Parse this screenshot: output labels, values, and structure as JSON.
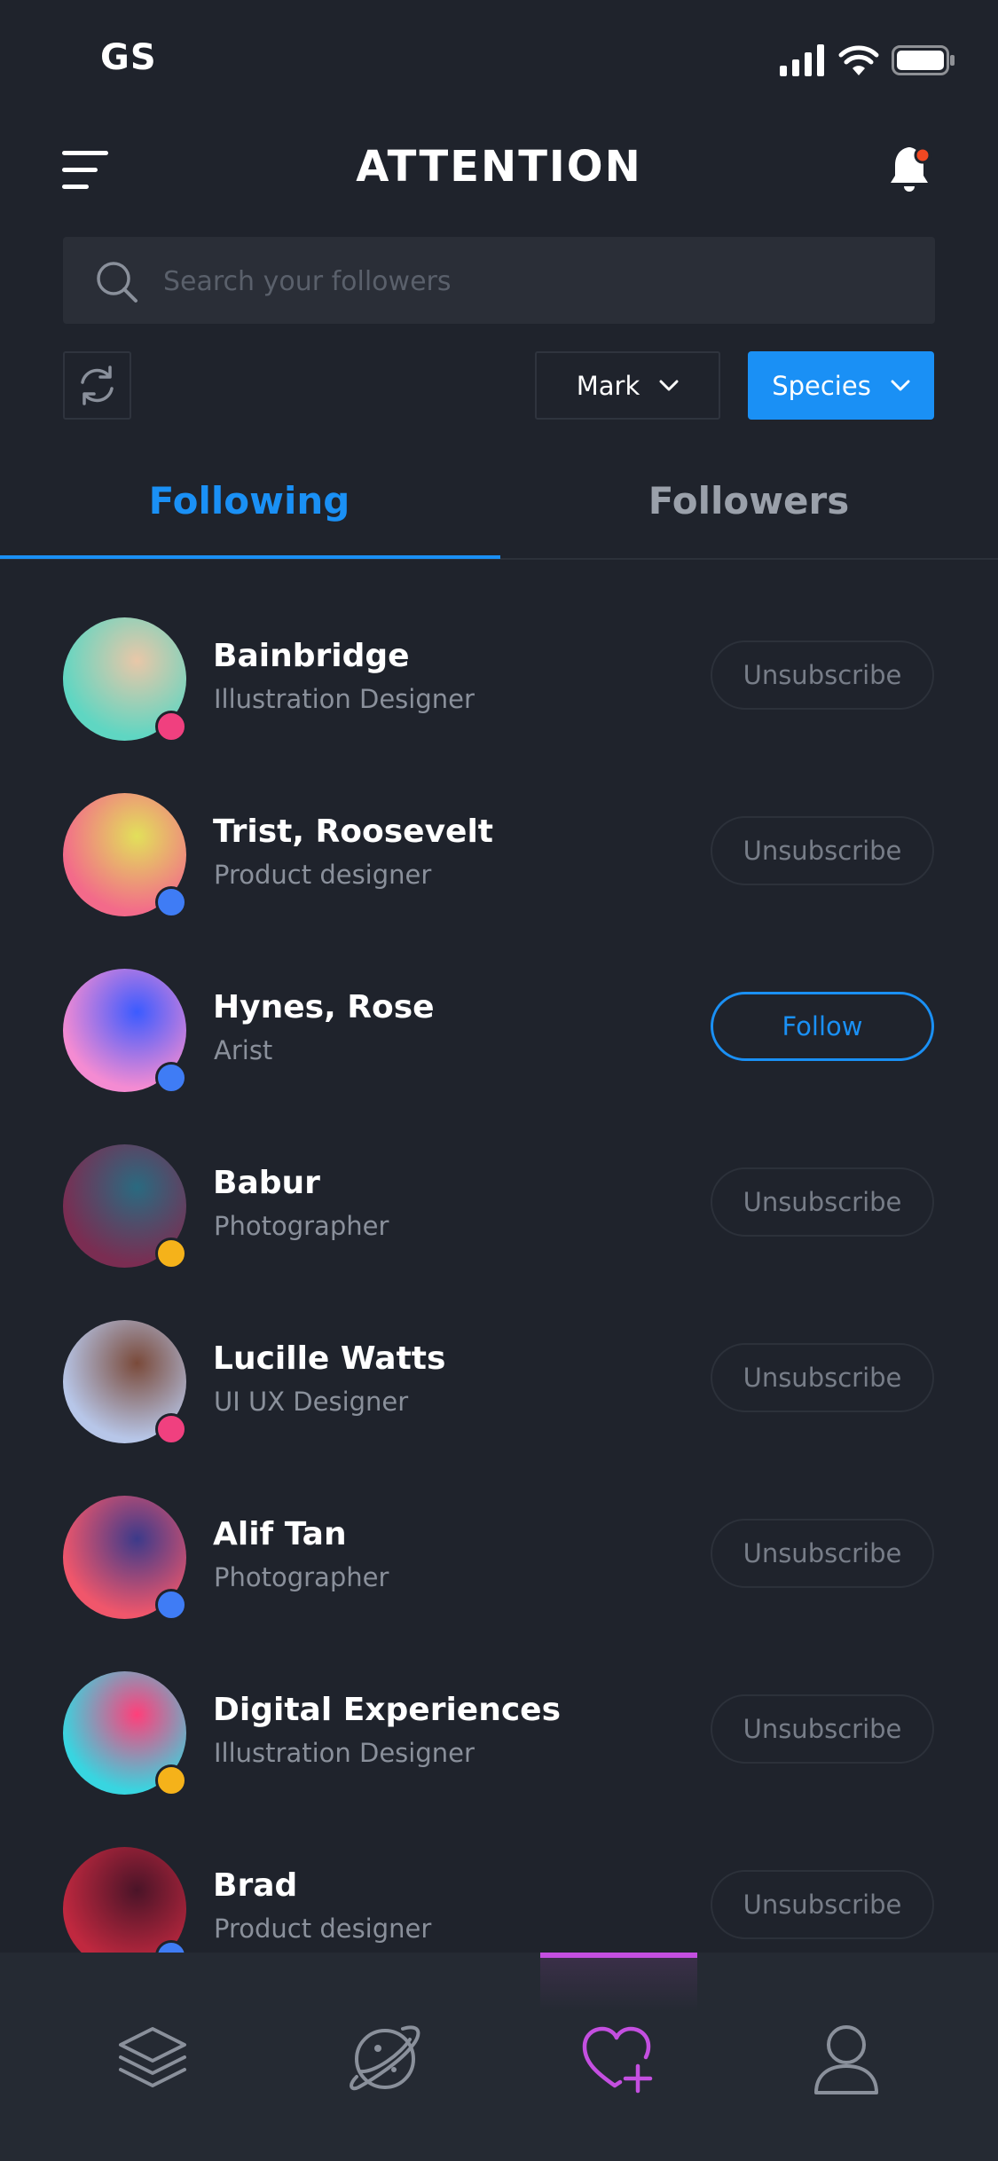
{
  "status_bar": {
    "carrier": "GS"
  },
  "header": {
    "title": "ATTENTION"
  },
  "search": {
    "placeholder": "Search your followers"
  },
  "filters": {
    "mark_label": "Mark",
    "species_label": "Species"
  },
  "tabs": [
    {
      "label": "Following",
      "active": true
    },
    {
      "label": "Followers",
      "active": false
    }
  ],
  "users": [
    {
      "name": "Bainbridge",
      "role": "Illustration Designer",
      "action": "Unsubscribe",
      "dot_color": "#f0407f",
      "avatar_colors": [
        "#5fd6c2",
        "#e9c7a8"
      ]
    },
    {
      "name": "Trist, Roosevelt",
      "role": "Product designer",
      "action": "Unsubscribe",
      "dot_color": "#3f7cf5",
      "avatar_colors": [
        "#f36a8a",
        "#e2e05a"
      ]
    },
    {
      "name": "Hynes, Rose",
      "role": "Arist",
      "action": "Follow",
      "dot_color": "#3f7cf5",
      "avatar_colors": [
        "#f48bd2",
        "#3b5bff"
      ]
    },
    {
      "name": "Babur",
      "role": "Photographer",
      "action": "Unsubscribe",
      "dot_color": "#f5b21a",
      "avatar_colors": [
        "#7a2d52",
        "#2a6a80"
      ]
    },
    {
      "name": "Lucille Watts",
      "role": "UI UX Designer",
      "action": "Unsubscribe",
      "dot_color": "#f0407f",
      "avatar_colors": [
        "#b7c6e8",
        "#7a4a3a"
      ]
    },
    {
      "name": "Alif Tan",
      "role": "Photographer",
      "action": "Unsubscribe",
      "dot_color": "#3f7cf5",
      "avatar_colors": [
        "#f0566b",
        "#3c3a8a"
      ]
    },
    {
      "name": "Digital Experiences",
      "role": "Illustration Designer",
      "action": "Unsubscribe",
      "dot_color": "#f5b21a",
      "avatar_colors": [
        "#38d5e0",
        "#ff3f7a"
      ]
    },
    {
      "name": "Brad",
      "role": "Product designer",
      "action": "Unsubscribe",
      "dot_color": "#3f7cf5",
      "avatar_colors": [
        "#c0283f",
        "#4a1428"
      ]
    }
  ],
  "bottom_nav": [
    {
      "icon": "layers-icon",
      "active": false
    },
    {
      "icon": "planet-icon",
      "active": false
    },
    {
      "icon": "heart-plus-icon",
      "active": true
    },
    {
      "icon": "profile-icon",
      "active": false
    }
  ],
  "colors": {
    "accent": "#1a90f5",
    "nav_active": "#c44fe0",
    "background": "#1f232c"
  }
}
